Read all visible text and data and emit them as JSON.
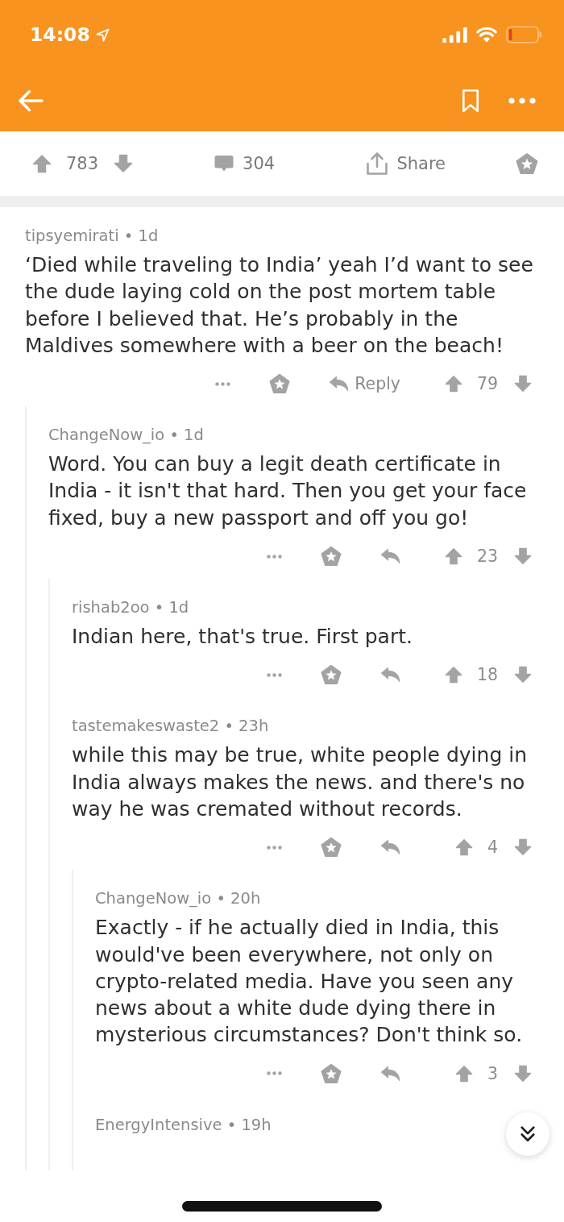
{
  "status_bar": {
    "time": "14:08"
  },
  "post_actions": {
    "upvotes": "783",
    "comments": "304",
    "share_label": "Share"
  },
  "comments": [
    {
      "byline": "tipsyemirati • 1d",
      "body": "‘Died while traveling to India’ yeah I’d want to see the dude laying cold on the post mortem table before I believed that. He’s probably in the Maldives somewhere with a beer on the beach!",
      "reply_label": "Reply",
      "score": "79",
      "children": [
        {
          "byline": "ChangeNow_io • 1d",
          "body": "Word. You can buy a legit death certificate in India - it isn't that hard. Then you get your face fixed, buy a new passport and off you go!",
          "score": "23",
          "children": [
            {
              "byline": "rishab2oo • 1d",
              "body": "Indian here, that's true. First part.",
              "score": "18"
            },
            {
              "byline": "tastemakeswaste2 • 23h",
              "body": "while this may be true, white people dying in India always makes the news. and there's no way he was cremated without records.",
              "score": "4",
              "children": [
                {
                  "byline": "ChangeNow_io • 20h",
                  "body": "Exactly - if he actually died in India, this would've been everywhere, not only on crypto-related media. Have you seen any news about a white dude dying there in mysterious circumstances? Don't think so.",
                  "score": "3"
                },
                {
                  "byline": "EnergyIntensive • 19h"
                }
              ]
            }
          ]
        }
      ]
    }
  ]
}
